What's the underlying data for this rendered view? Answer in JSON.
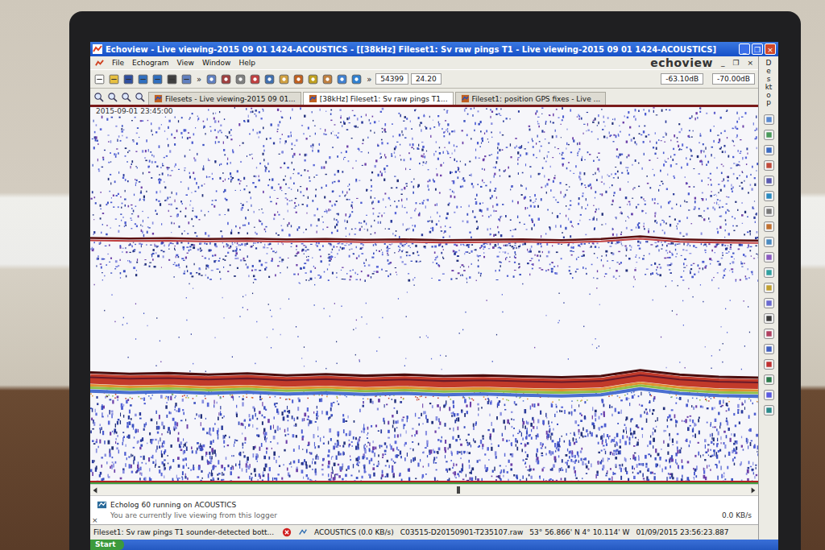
{
  "window": {
    "title": "Echoview - Live viewing-2015 09 01 1424-ACOUSTICS - [[38kHz] Fileset1: Sv raw pings T1 - Live viewing-2015 09 01 1424-ACOUSTICS]",
    "controls": [
      "_",
      "❐",
      "×"
    ]
  },
  "menu": [
    "File",
    "Echogram",
    "View",
    "Window",
    "Help"
  ],
  "logo": "echoview",
  "mdi_controls": [
    "_",
    "❐",
    "×"
  ],
  "toolbar": {
    "overflow": [
      "»",
      "»"
    ],
    "fields": [
      "54399",
      "24.20"
    ],
    "readings": [
      "-63.10dB",
      "-70.00dB"
    ]
  },
  "tabs": [
    {
      "label": "Filesets - Live viewing-2015 09 01...",
      "selected": false
    },
    {
      "label": "[38kHz] Fileset1: Sv raw pings T1...",
      "selected": true
    },
    {
      "label": "Fileset1: position GPS fixes - Live ...",
      "selected": false
    }
  ],
  "echogram": {
    "timestamp": "2015-09-01 23:45:00",
    "surface_line": [
      35.0,
      35.2,
      35.1,
      35.3,
      35.2,
      35.4,
      35.3,
      35.5,
      35.4,
      35.6,
      35.5,
      35.4,
      35.6,
      35.3,
      34.6,
      35.4,
      35.6,
      35.7
    ],
    "bottom_line": [
      71.0,
      71.4,
      71.2,
      71.6,
      71.3,
      71.8,
      71.5,
      71.9,
      71.6,
      72.0,
      71.8,
      72.1,
      72.3,
      72.0,
      70.4,
      71.6,
      72.2,
      72.4
    ]
  },
  "scrollbar": {
    "position": 0.55
  },
  "sidebar": {
    "label": "Desktop"
  },
  "log": {
    "title": "Echolog 60 running on ACOUSTICS",
    "message": "You are currently live viewing from this logger",
    "rate": "0.0 KB/s",
    "close": "×"
  },
  "status_bar": {
    "items": [
      "Fileset1: Sv raw pings T1 sounder-detected bott...",
      "ACOUSTICS (0.0 KB/s)",
      "C03515-D20150901-T235107.raw",
      "53° 56.866' N 4° 10.114' W",
      "01/09/2015 23:56:23.887"
    ]
  },
  "taskbar": {
    "start": "Start"
  }
}
